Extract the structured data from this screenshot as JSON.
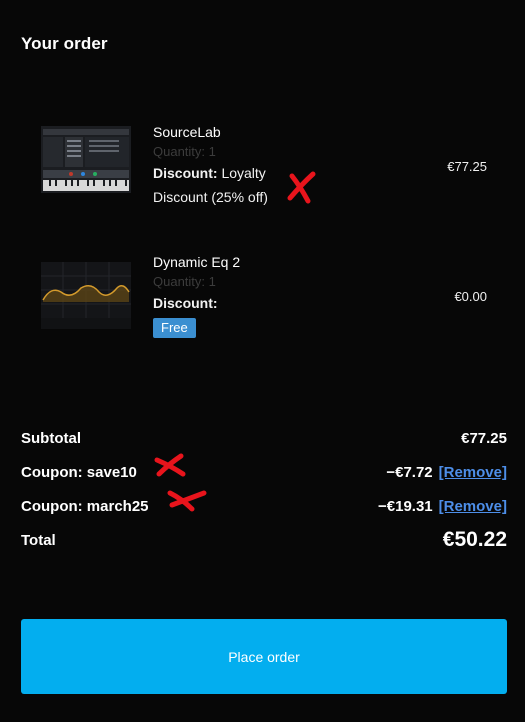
{
  "title": "Your order",
  "items": [
    {
      "name": "SourceLab",
      "quantity": "Quantity: 1",
      "discount_label": "Discount:",
      "discount_text_1": "Loyalty",
      "discount_text_2": "Discount (25% off)",
      "price": "€77.25",
      "thumbnail_icon": "synth-plugin-thumbnail"
    },
    {
      "name": "Dynamic Eq 2",
      "quantity": "Quantity: 1",
      "discount_label": "Discount:",
      "badge": "Free",
      "price": "€0.00",
      "thumbnail_icon": "eq-plugin-thumbnail"
    }
  ],
  "summary": {
    "subtotal_label": "Subtotal",
    "subtotal_value": "€77.25",
    "coupons": [
      {
        "label": "Coupon: save10",
        "value": "−€7.72",
        "remove": "[Remove]"
      },
      {
        "label": "Coupon: march25",
        "value": "−€19.31",
        "remove": "[Remove]"
      }
    ],
    "total_label": "Total",
    "total_value": "€50.22"
  },
  "place_order": "Place order",
  "colors": {
    "background": "#070707",
    "button": "#03aeef",
    "badge": "#3b8fd1",
    "link": "#4d8ee8",
    "annotation": "#e8141c"
  }
}
